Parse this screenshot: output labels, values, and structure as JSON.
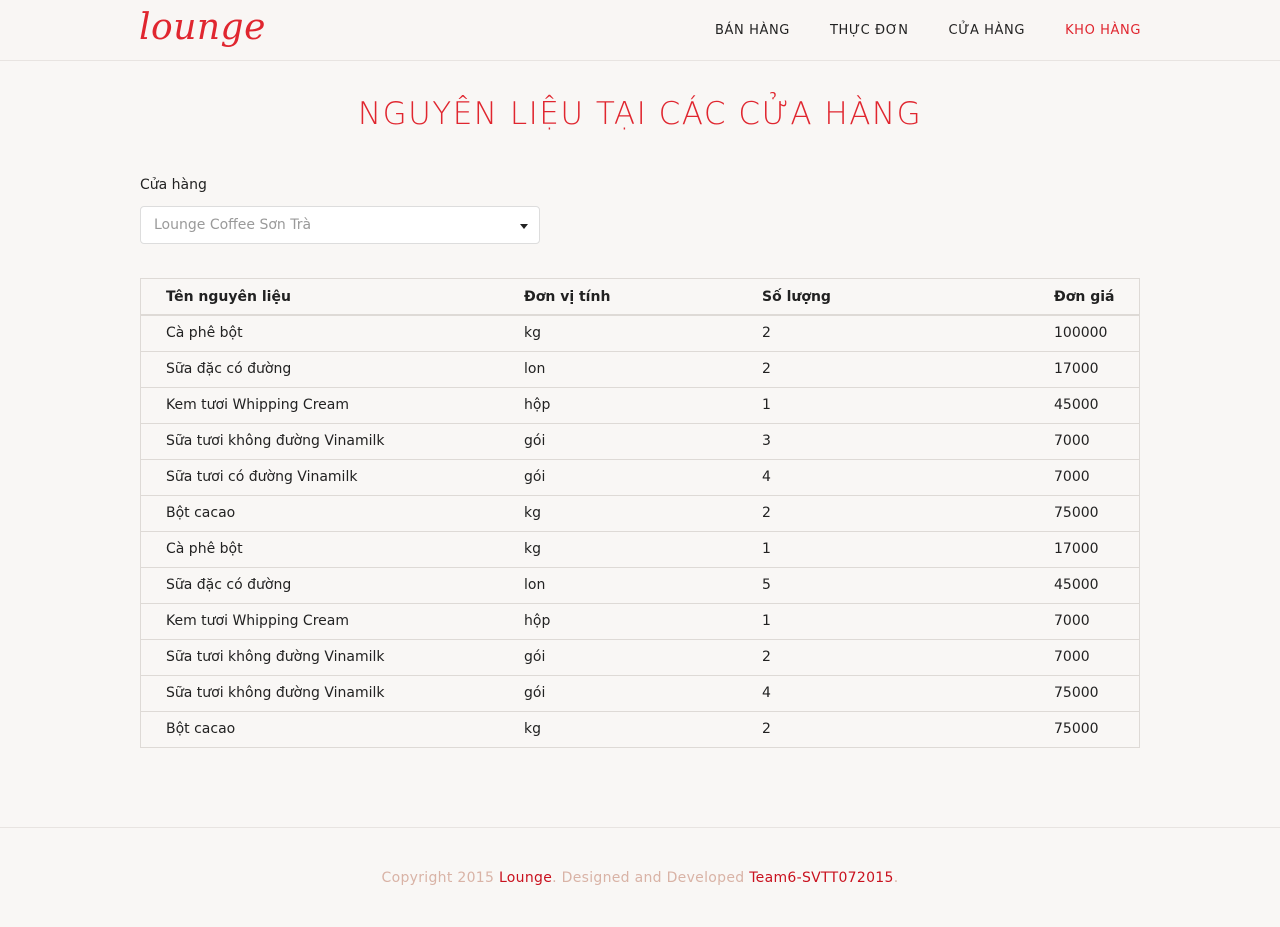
{
  "brand": {
    "logo": "lounge",
    "accent": "#e0262f"
  },
  "nav": {
    "items": [
      {
        "label": "BÁN HÀNG",
        "active": false
      },
      {
        "label": "THỰC ĐƠN",
        "active": false
      },
      {
        "label": "CỬA HÀNG",
        "active": false
      },
      {
        "label": "KHO HÀNG",
        "active": true
      }
    ]
  },
  "main": {
    "title": "NGUYÊN LIỆU TẠI CÁC CỬA HÀNG",
    "store_label": "Cửa hàng",
    "store_selected": "Lounge Coffee Sơn Trà",
    "table": {
      "headers": [
        "Tên nguyên liệu",
        "Đơn vị tính",
        "Số lượng",
        "Đơn giá"
      ],
      "rows": [
        [
          "Cà phê bột",
          "kg",
          "2",
          "100000"
        ],
        [
          "Sữa đặc có đường",
          "lon",
          "2",
          "17000"
        ],
        [
          "Kem tươi Whipping Cream",
          "hộp",
          "1",
          "45000"
        ],
        [
          "Sữa tươi không đường Vinamilk",
          "gói",
          "3",
          "7000"
        ],
        [
          "Sữa tươi có đường Vinamilk",
          "gói",
          "4",
          "7000"
        ],
        [
          "Bột cacao",
          "kg",
          "2",
          "75000"
        ],
        [
          "Cà phê bột",
          "kg",
          "1",
          "17000"
        ],
        [
          "Sữa đặc có đường",
          "lon",
          "5",
          "45000"
        ],
        [
          "Kem tươi Whipping Cream",
          "hộp",
          "1",
          "7000"
        ],
        [
          "Sữa tươi không đường Vinamilk",
          "gói",
          "2",
          "7000"
        ],
        [
          "Sữa tươi không đường Vinamilk",
          "gói",
          "4",
          "75000"
        ],
        [
          "Bột cacao",
          "kg",
          "2",
          "75000"
        ]
      ]
    }
  },
  "footer": {
    "prefix": "Copyright 2015 ",
    "brand_link": "Lounge",
    "middle": ". Designed and Developed ",
    "team_link": "Team6-SVTT072015",
    "suffix": "."
  }
}
